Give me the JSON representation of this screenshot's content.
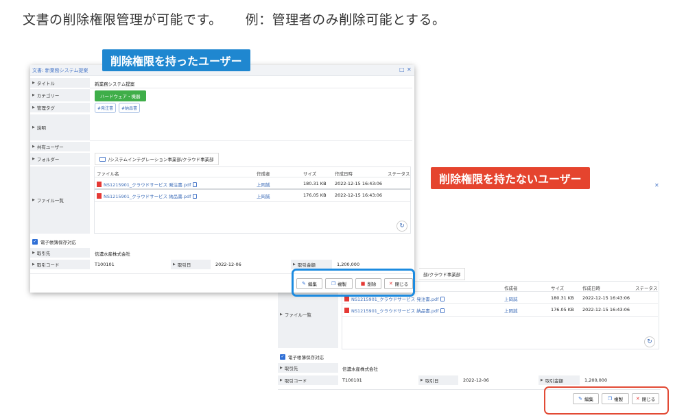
{
  "headline": {
    "part1": "文書の削除権限管理が可能です。",
    "part2": "例：管理者のみ削除可能とする。"
  },
  "banners": {
    "with_permission": "削除権限を持ったユーザー",
    "without_permission": "削除権限を持たないユーザー"
  },
  "window": {
    "title": "文書: 新業務システム提案",
    "maximize_icon": "□",
    "close_icon": "✕"
  },
  "fields": {
    "title": {
      "label": "タイトル",
      "value": "新業務システム提案"
    },
    "category": {
      "label": "カテゴリー",
      "value": "ハードウェア・機器"
    },
    "tags": {
      "label": "管理タグ",
      "items": [
        "#発注書",
        "#納品書"
      ]
    },
    "description": {
      "label": "説明"
    },
    "shared_users": {
      "label": "共有ユーザー"
    },
    "folder": {
      "label": "フォルダー",
      "value": "/システムインテグレーション事業部/クラウド事業部",
      "value_cropped": "部/クラウド事業部"
    },
    "file_list": {
      "label": "ファイル一覧"
    }
  },
  "file_table": {
    "headers": {
      "name": "ファイル名",
      "creator": "作成者",
      "size": "サイズ",
      "created": "作成日時",
      "status": "ステータス"
    },
    "rows": [
      {
        "name": "NS1215901_クラウドサービス 発注書.pdf",
        "creator": "上岡誠",
        "size": "180.31 KB",
        "created": "2022-12-15 16:43:06"
      },
      {
        "name": "NS1215901_クラウドサービス 納品書.pdf",
        "creator": "上岡誠",
        "size": "176.05 KB",
        "created": "2022-12-15 16:43:06"
      }
    ],
    "refresh_icon": "↻"
  },
  "ebook": {
    "label": "電子帳簿保存対応",
    "client": {
      "label": "取引先",
      "value": "信濃水産株式会社"
    },
    "code": {
      "label": "取引コード",
      "value": "T100101"
    },
    "date": {
      "label": "取引日",
      "value": "2022-12-06"
    },
    "amount": {
      "label": "取引金額",
      "value": "1,200,000"
    }
  },
  "actions": {
    "edit": "編集",
    "copy": "複製",
    "delete": "削除",
    "close": "閉じる"
  },
  "colors": {
    "accent_blue": "#1f87d0",
    "accent_red": "#e5442e",
    "category_green": "#3fae49"
  }
}
